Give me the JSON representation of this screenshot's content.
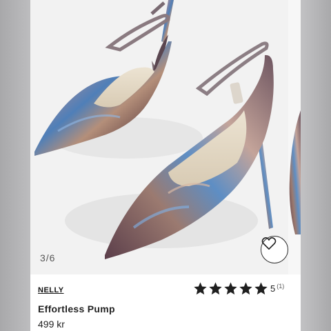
{
  "gallery": {
    "counter": "3/6",
    "product_image": "iridescent-pointed-pump-heels",
    "favorite_icon": "heart-icon"
  },
  "product": {
    "brand": "NELLY",
    "name": "Effortless Pump",
    "price": "499 kr",
    "rating": {
      "value": "5",
      "count": "(1)",
      "stars_filled": 5,
      "stars_total": 5
    }
  }
}
